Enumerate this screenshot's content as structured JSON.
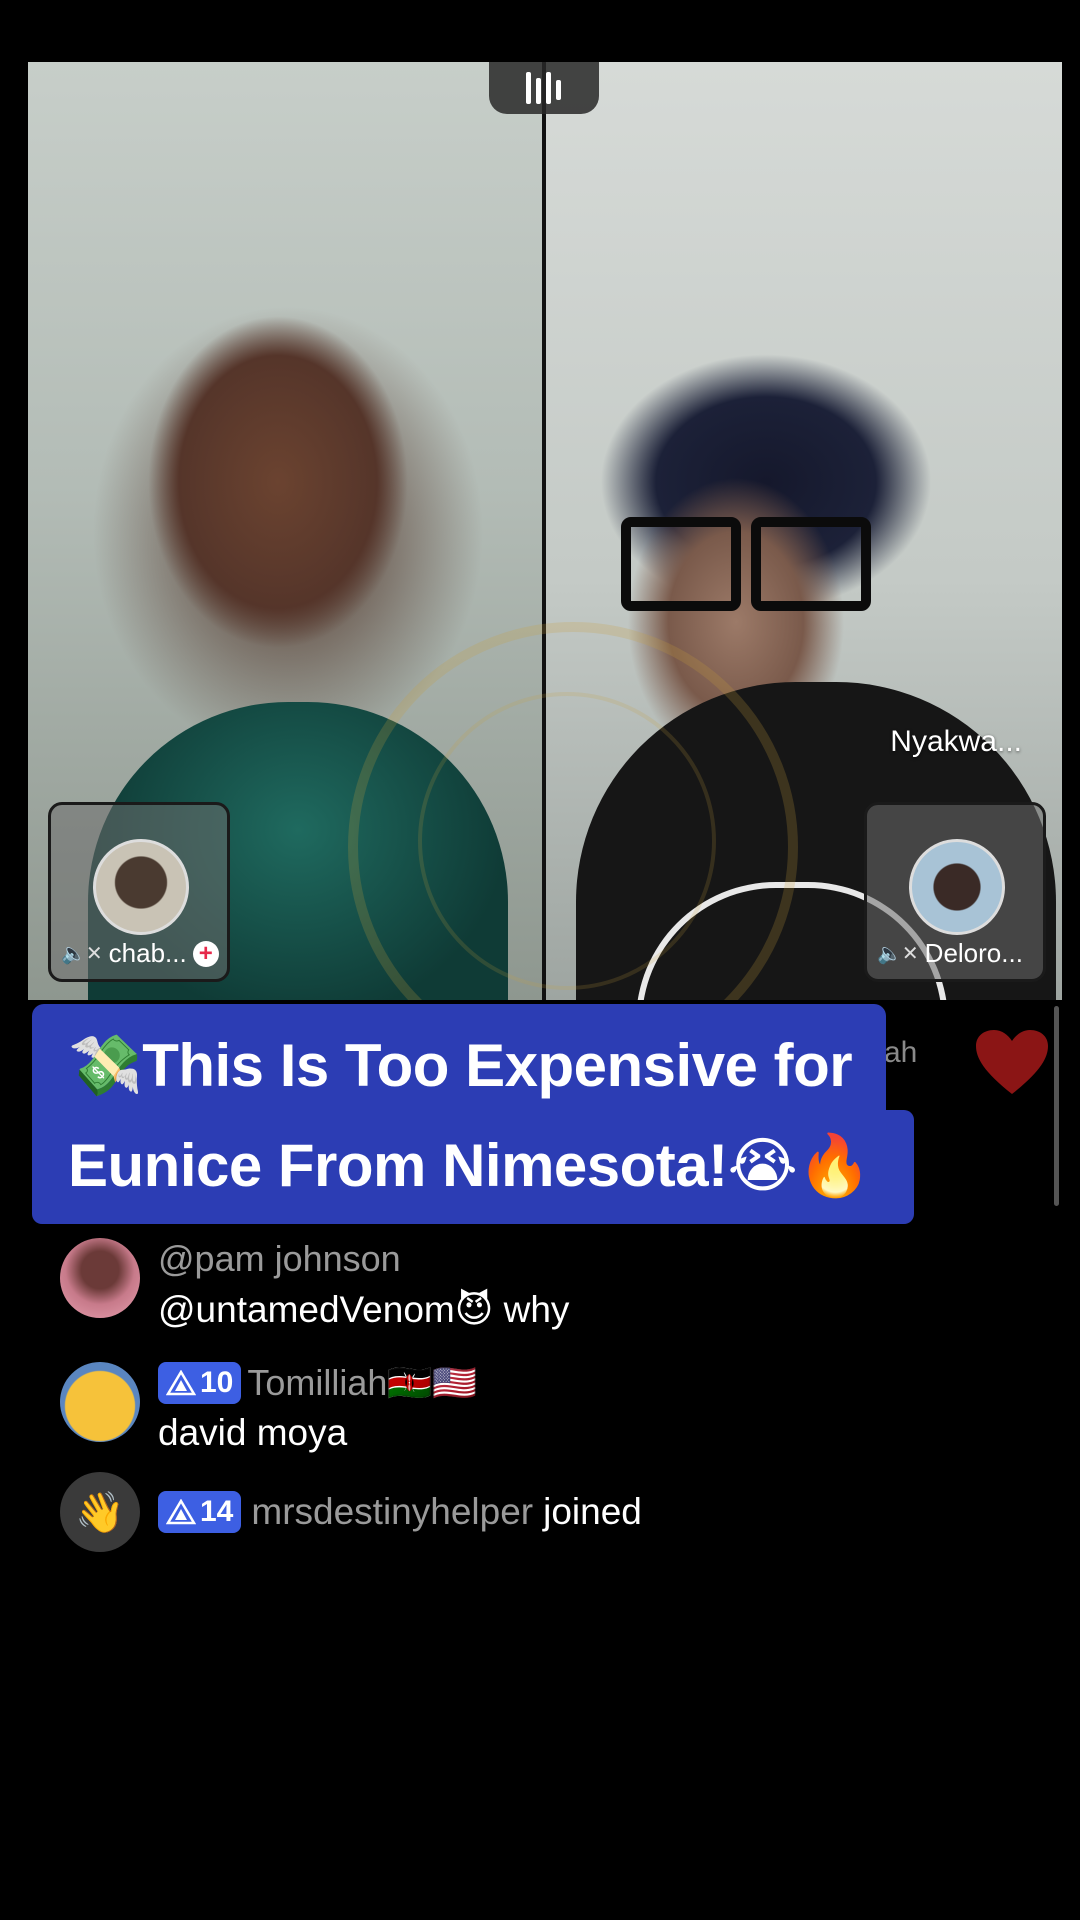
{
  "stream": {
    "host_name": "Nyakwa...",
    "guests": [
      {
        "name": "chab...",
        "muted": true,
        "has_add_button": true
      },
      {
        "name": "Deloro...",
        "muted": true,
        "has_add_button": false
      }
    ],
    "peek_comment_name": "ah"
  },
  "caption": {
    "line1": "💸This Is Too Expensive for",
    "line2": "Eunice From Nimesota!😭🔥",
    "background_color": "#2c3db4"
  },
  "comments": [
    {
      "username": "@pam johnson",
      "message": "@untamedVenom😈  why"
    },
    {
      "badge_level": "10",
      "username": "Tomilliah🇰🇪🇺🇸",
      "message": "david moya"
    },
    {
      "avatar_icon": "👋",
      "badge_level": "14",
      "username": "mrsdestinyhelper",
      "action": "joined"
    }
  ],
  "colors": {
    "badge": "#3d5fe3",
    "heart": "#8b1515",
    "plus": "#e6294a"
  }
}
